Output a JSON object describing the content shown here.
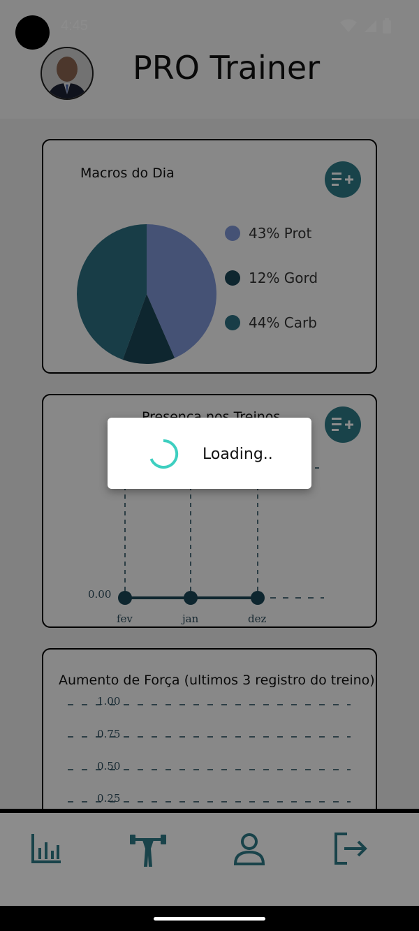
{
  "status_bar": {
    "time": "4:45",
    "icons": [
      "wifi-icon",
      "signal-icon",
      "battery-icon"
    ]
  },
  "header": {
    "title": "PRO Trainer",
    "avatar": "profile-avatar"
  },
  "macros_card": {
    "title": "Macros do Dia",
    "action_icon": "list-add-icon",
    "legend": [
      {
        "label": "43% Prot",
        "color": "#7f96d6"
      },
      {
        "label": "12% Gord",
        "color": "#1b4556"
      },
      {
        "label": "44% Carb",
        "color": "#2c6f82"
      }
    ]
  },
  "chart_data": [
    {
      "type": "pie",
      "title": "Macros do Dia",
      "categories": [
        "Prot",
        "Gord",
        "Carb"
      ],
      "values": [
        43,
        12,
        44
      ],
      "colors": [
        "#7f96d6",
        "#1b4556",
        "#2c6f82"
      ]
    },
    {
      "type": "line",
      "title": "Presença nos Treinos",
      "categories": [
        "fev",
        "jan",
        "dez"
      ],
      "values": [
        0,
        0,
        0
      ],
      "y_tick_labels": [
        "0.00"
      ],
      "grid": true
    },
    {
      "type": "line",
      "title": "Aumento de Força (ultimos 3 registro do treino)",
      "y_tick_labels": [
        "1.00",
        "0.75",
        "0.50",
        "0.25"
      ],
      "grid": true
    }
  ],
  "presence_card": {
    "title": "Presença nos Treinos",
    "action_icon": "list-add-icon",
    "y_label": "0.00",
    "x_labels": [
      "fev",
      "jan",
      "dez"
    ]
  },
  "strength_card": {
    "title": "Aumento de Força (ultimos 3 registro do treino)",
    "y_labels": [
      "1.00",
      "0.75",
      "0.50",
      "0.25"
    ]
  },
  "bottom_nav": {
    "items": [
      "bar-chart-icon",
      "dumbbell-icon",
      "user-icon",
      "logout-icon"
    ]
  },
  "dialog": {
    "text": "Loading..",
    "icon": "spinner-icon"
  },
  "colors": {
    "accent": "#2f7a88",
    "dark": "#1b4556",
    "spinner": "#3ecfc0"
  }
}
